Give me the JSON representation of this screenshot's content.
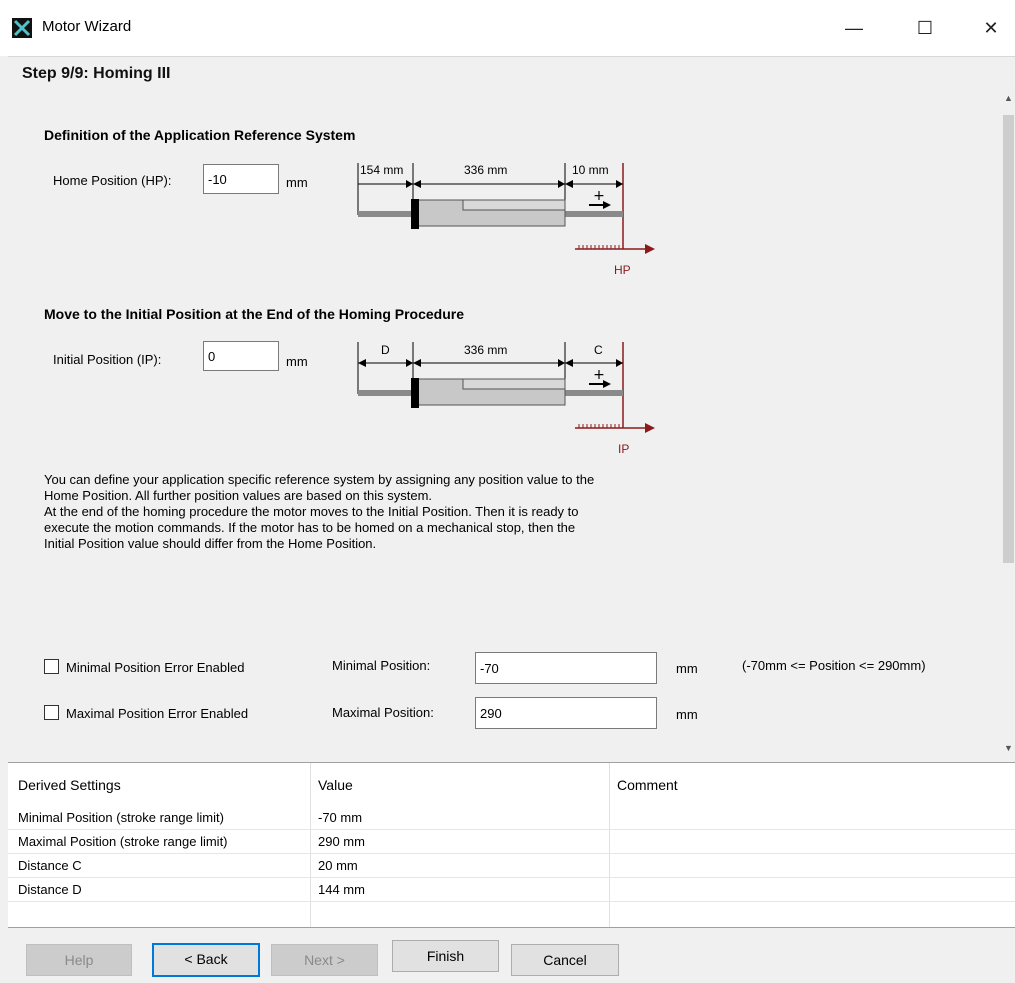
{
  "window": {
    "title": "Motor Wizard",
    "minimize": "—",
    "maximize": "☐",
    "close": "✕"
  },
  "step": {
    "title": "Step 9/9: Homing III"
  },
  "section1": {
    "heading": "Definition of the Application Reference System",
    "label": "Home Position (HP):",
    "value": "-10",
    "unit": "mm",
    "diagram": {
      "left": "154 mm",
      "middle": "336 mm",
      "right": "10 mm",
      "marker": "HP"
    }
  },
  "section2": {
    "heading": "Move to the Initial Position at the End of the Homing Procedure",
    "label": "Initial Position (IP):",
    "value": "0",
    "unit": "mm",
    "diagram": {
      "left": "D",
      "middle": "336 mm",
      "right": "C",
      "marker": "IP"
    }
  },
  "description": [
    "You can define your application specific reference system by assigning any position value to the",
    "Home Position. All further position values are based on this system.",
    "At the end of the homing procedure the motor moves to the Initial Position. Then it is ready to",
    "execute the motion commands. If the motor has to be homed on a mechanical stop, then the",
    "Initial Position value should differ from the Home Position."
  ],
  "limits": {
    "min_checkbox": "Minimal Position Error Enabled",
    "min_label": "Minimal Position:",
    "min_value": "-70",
    "min_unit": "mm",
    "range_note": "(-70mm <= Position <= 290mm)",
    "max_checkbox": "Maximal Position Error Enabled",
    "max_label": "Maximal Position:",
    "max_value": "290",
    "max_unit": "mm"
  },
  "derived": {
    "headers": [
      "Derived Settings",
      "Value",
      "Comment"
    ],
    "rows": [
      {
        "setting": "Minimal Position (stroke range limit)",
        "value": "-70 mm",
        "comment": ""
      },
      {
        "setting": "Maximal Position (stroke range limit)",
        "value": "290 mm",
        "comment": ""
      },
      {
        "setting": "Distance C",
        "value": "20 mm",
        "comment": ""
      },
      {
        "setting": "Distance D",
        "value": "144 mm",
        "comment": ""
      }
    ]
  },
  "buttons": {
    "help": "Help",
    "back": "< Back",
    "next": "Next >",
    "finish": "Finish",
    "cancel": "Cancel"
  },
  "colors": {
    "accent": "#0078d7",
    "marker": "#8b1a1a"
  }
}
